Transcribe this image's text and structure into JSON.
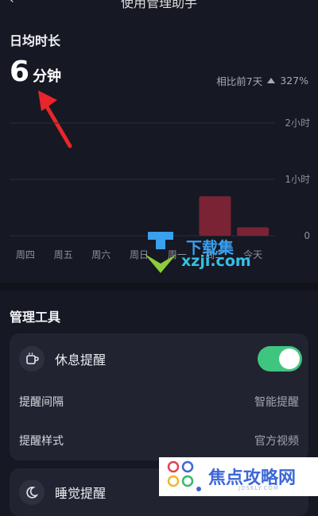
{
  "header": {
    "title": "使用管理助手"
  },
  "stats": {
    "section_label": "日均时长",
    "value": "6",
    "unit": "分钟",
    "compare_label": "相比前7天",
    "compare_change": "327%"
  },
  "chart_data": {
    "type": "bar",
    "categories": [
      "周四",
      "周五",
      "周六",
      "周日",
      "周一",
      "周二",
      "今天"
    ],
    "values": [
      0,
      0,
      0,
      0,
      0,
      0.7,
      0.15
    ],
    "ytick_labels": [
      "0",
      "1小时",
      "2小时"
    ],
    "ylim": [
      0,
      2
    ],
    "bar_color": "#7a2335"
  },
  "tools": {
    "title": "管理工具",
    "rest_reminder": {
      "title": "休息提醒",
      "enabled": true,
      "interval_label": "提醒间隔",
      "interval_value": "智能提醒",
      "style_label": "提醒样式",
      "style_value": "官方视频"
    },
    "sleep_reminder": {
      "title": "睡觉提醒"
    }
  },
  "watermarks": {
    "top_brand": "下载集",
    "top_url": "xzji.com",
    "bottom_brand": "焦点攻略网",
    "bottom_sub": "JDSKLY.COM"
  },
  "colors": {
    "background": "#161823",
    "card": "#212330",
    "toggle_on": "#3fc57f",
    "annotation_arrow": "#e8262a"
  }
}
